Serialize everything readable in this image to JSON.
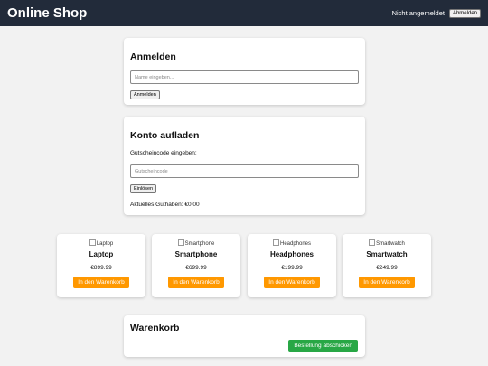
{
  "header": {
    "brand": "Online Shop",
    "user_status": "Nicht angemeldet",
    "logout_label": "Abmelden"
  },
  "login": {
    "title": "Anmelden",
    "name_placeholder": "Name eingeben...",
    "name_value": "",
    "submit_label": "Anmelden"
  },
  "topup": {
    "title": "Konto aufladen",
    "voucher_label": "Gutscheincode eingeben:",
    "voucher_placeholder": "Gutscheincode",
    "voucher_value": "",
    "redeem_label": "Einlösen",
    "balance_text": "Aktuelles Guthaben: €0.00"
  },
  "products": [
    {
      "name": "Laptop",
      "img_alt": "Laptop",
      "price": "€899.99",
      "button_label": "In den Warenkorb"
    },
    {
      "name": "Smartphone",
      "img_alt": "Smartphone",
      "price": "€699.99",
      "button_label": "In den Warenkorb"
    },
    {
      "name": "Headphones",
      "img_alt": "Headphones",
      "price": "€199.99",
      "button_label": "In den Warenkorb"
    },
    {
      "name": "Smartwatch",
      "img_alt": "Smartwatch",
      "price": "€249.99",
      "button_label": "In den Warenkorb"
    }
  ],
  "cart": {
    "title": "Warenkorb",
    "checkout_label": "Bestellung abschicken"
  },
  "colors": {
    "header_bg": "#222b3a",
    "cart_button": "#ff9800",
    "checkout_button": "#28a745",
    "page_bg": "#f2f2f2"
  }
}
